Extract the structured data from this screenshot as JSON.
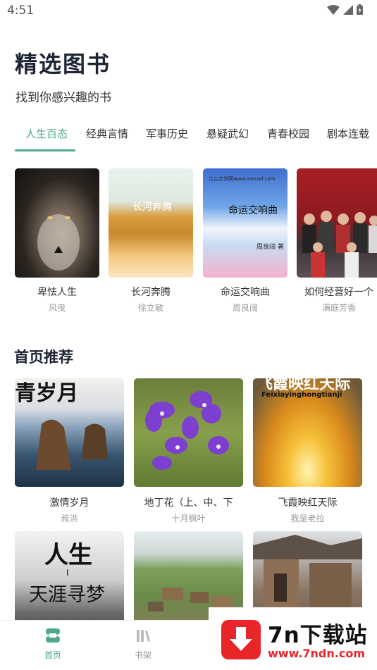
{
  "status_bar": {
    "time": "4:51"
  },
  "header": {
    "title": "精选图书",
    "subtitle": "找到你感兴趣的书"
  },
  "tabs": [
    {
      "label": "人生百态",
      "active": true
    },
    {
      "label": "经典言情"
    },
    {
      "label": "军事历史"
    },
    {
      "label": "悬疑武幻"
    },
    {
      "label": "青春校园"
    },
    {
      "label": "剧本连载"
    }
  ],
  "featured_books": [
    {
      "title": "卑怯人生",
      "author": "风曳"
    },
    {
      "title": "长河奔腾",
      "author": "徐立敏",
      "cover_text": "长河奔腾"
    },
    {
      "title": "命运交响曲",
      "author": "周良阔",
      "cover_text": "命运交响曲",
      "cover_top": "江山文学网www.vsread.com",
      "cover_author": "周良阔 著"
    },
    {
      "title": "如何经营好一个",
      "author": "满庭芳香"
    }
  ],
  "recommend": {
    "title": "首页推荐",
    "books": [
      {
        "title": "激情岁月",
        "author": "叔洪",
        "cover_text": "青岁月"
      },
      {
        "title": "地丁花（上、中、下",
        "author": "十月枫叶"
      },
      {
        "title": "飞霞映红天际",
        "author": "我是老拉",
        "cover_text": "飞霞映红天际",
        "cover_pinyin": "Feixiayinghongtianji"
      },
      {
        "cover_text": "人生",
        "cover_sep": "I",
        "cover_sub": "天涯寻梦"
      },
      {},
      {}
    ]
  },
  "bottom_nav": [
    {
      "label": "首页",
      "active": true
    },
    {
      "label": "书架"
    }
  ],
  "watermark": {
    "brand": "7n下载站",
    "url": "www.7ndn.com"
  },
  "colors": {
    "accent": "#4fa98c",
    "title": "#1d2433",
    "muted": "#9a9a9a",
    "watermark_red": "#e8262a"
  }
}
